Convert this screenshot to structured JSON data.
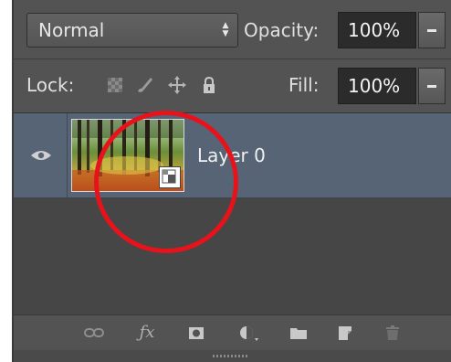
{
  "blend": {
    "mode": "Normal"
  },
  "opacity": {
    "label": "Opacity:",
    "value": "100%"
  },
  "lock": {
    "label": "Lock:"
  },
  "fill": {
    "label": "Fill:",
    "value": "100%"
  },
  "layers": [
    {
      "name": "Layer 0",
      "visible": true,
      "selected": true,
      "smart_object": true
    }
  ],
  "icons": {
    "dropdown": "updown-arrows-icon",
    "slider": "triangle-down-icon",
    "lock_transparent": "checkerboard-icon",
    "lock_image": "brush-icon",
    "lock_position": "move-icon",
    "lock_all": "padlock-icon",
    "visibility": "eye-icon",
    "toolbar": [
      "link-icon",
      "fx-icon",
      "mask-icon",
      "adjustment-icon",
      "folder-icon",
      "new-layer-icon",
      "trash-icon"
    ]
  },
  "colors": {
    "panel": "#535353",
    "selected_row": "#576476",
    "annotation": "#e8121a"
  }
}
